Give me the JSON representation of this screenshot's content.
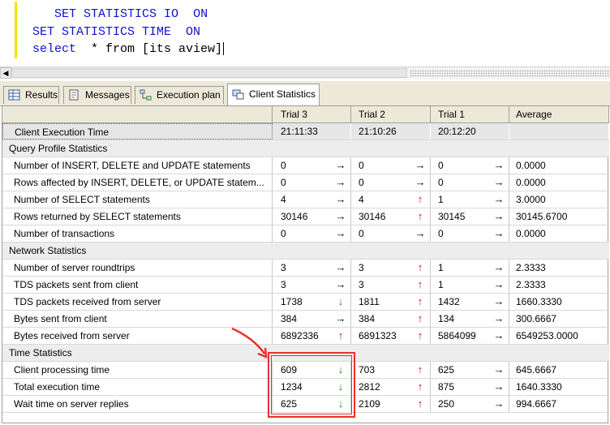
{
  "editor": {
    "line1": {
      "kw1": "SET STATISTICS IO",
      "val": "ON"
    },
    "line2": {
      "kw1": "SET STATISTICS TIME",
      "val": "ON"
    },
    "line3": {
      "kw1": "select",
      "rest": "* from [its aview]"
    }
  },
  "tabs": [
    {
      "label": "Results",
      "icon": "grid-icon"
    },
    {
      "label": "Messages",
      "icon": "messages-icon"
    },
    {
      "label": "Execution plan",
      "icon": "execution-plan-icon"
    },
    {
      "label": "Client Statistics",
      "icon": "client-statistics-icon"
    }
  ],
  "columns": [
    "",
    "Trial 3",
    "Trial 2",
    "Trial 1",
    "Average"
  ],
  "exec_row": {
    "label": "Client Execution Time",
    "t3": "21:11:33",
    "t2": "21:10:26",
    "t1": "20:12:20",
    "avg": ""
  },
  "sections": {
    "query_profile": "Query Profile Statistics",
    "network": "Network Statistics",
    "time": "Time Statistics"
  },
  "rows": {
    "r1": {
      "label": "Number of INSERT, DELETE and UPDATE statements",
      "t3": "0",
      "a3": "right",
      "t2": "0",
      "a2": "right",
      "t1": "0",
      "a1": "right",
      "avg": "0.0000"
    },
    "r2": {
      "label": "Rows affected by INSERT, DELETE, or UPDATE statem...",
      "t3": "0",
      "a3": "right",
      "t2": "0",
      "a2": "right",
      "t1": "0",
      "a1": "right",
      "avg": "0.0000"
    },
    "r3": {
      "label": "Number of SELECT statements",
      "t3": "4",
      "a3": "right",
      "t2": "4",
      "a2": "up",
      "t1": "1",
      "a1": "right",
      "avg": "3.0000"
    },
    "r4": {
      "label": "Rows returned by SELECT statements",
      "t3": "30146",
      "a3": "right",
      "t2": "30146",
      "a2": "up",
      "t1": "30145",
      "a1": "right",
      "avg": "30145.6700"
    },
    "r5": {
      "label": "Number of transactions",
      "t3": "0",
      "a3": "right",
      "t2": "0",
      "a2": "right",
      "t1": "0",
      "a1": "right",
      "avg": "0.0000"
    },
    "r6": {
      "label": "Number of server roundtrips",
      "t3": "3",
      "a3": "right",
      "t2": "3",
      "a2": "up",
      "t1": "1",
      "a1": "right",
      "avg": "2.3333"
    },
    "r7": {
      "label": "TDS packets sent from client",
      "t3": "3",
      "a3": "right",
      "t2": "3",
      "a2": "up",
      "t1": "1",
      "a1": "right",
      "avg": "2.3333"
    },
    "r8": {
      "label": "TDS packets received from server",
      "t3": "1738",
      "a3": "down",
      "t2": "1811",
      "a2": "up",
      "t1": "1432",
      "a1": "right",
      "avg": "1660.3330"
    },
    "r9": {
      "label": "Bytes sent from client",
      "t3": "384",
      "a3": "right",
      "t2": "384",
      "a2": "up",
      "t1": "134",
      "a1": "right",
      "avg": "300.6667"
    },
    "r10": {
      "label": "Bytes received from server",
      "t3": "6892336",
      "a3": "up",
      "t2": "6891323",
      "a2": "up",
      "t1": "5864099",
      "a1": "right",
      "avg": "6549253.0000"
    },
    "r11": {
      "label": "Client processing time",
      "t3": "609",
      "a3": "down",
      "t2": "703",
      "a2": "up",
      "t1": "625",
      "a1": "right",
      "avg": "645.6667"
    },
    "r12": {
      "label": "Total execution time",
      "t3": "1234",
      "a3": "down",
      "t2": "2812",
      "a2": "up",
      "t1": "875",
      "a1": "right",
      "avg": "1640.3330"
    },
    "r13": {
      "label": "Wait time on server replies",
      "t3": "625",
      "a3": "down",
      "t2": "2109",
      "a2": "up",
      "t1": "250",
      "a1": "right",
      "avg": "994.6667"
    }
  },
  "colors": {
    "up": "#cc1010",
    "down": "#1f8a1f",
    "right": "#000000",
    "annotation": "#e83030",
    "keyword": "#1010d0"
  }
}
